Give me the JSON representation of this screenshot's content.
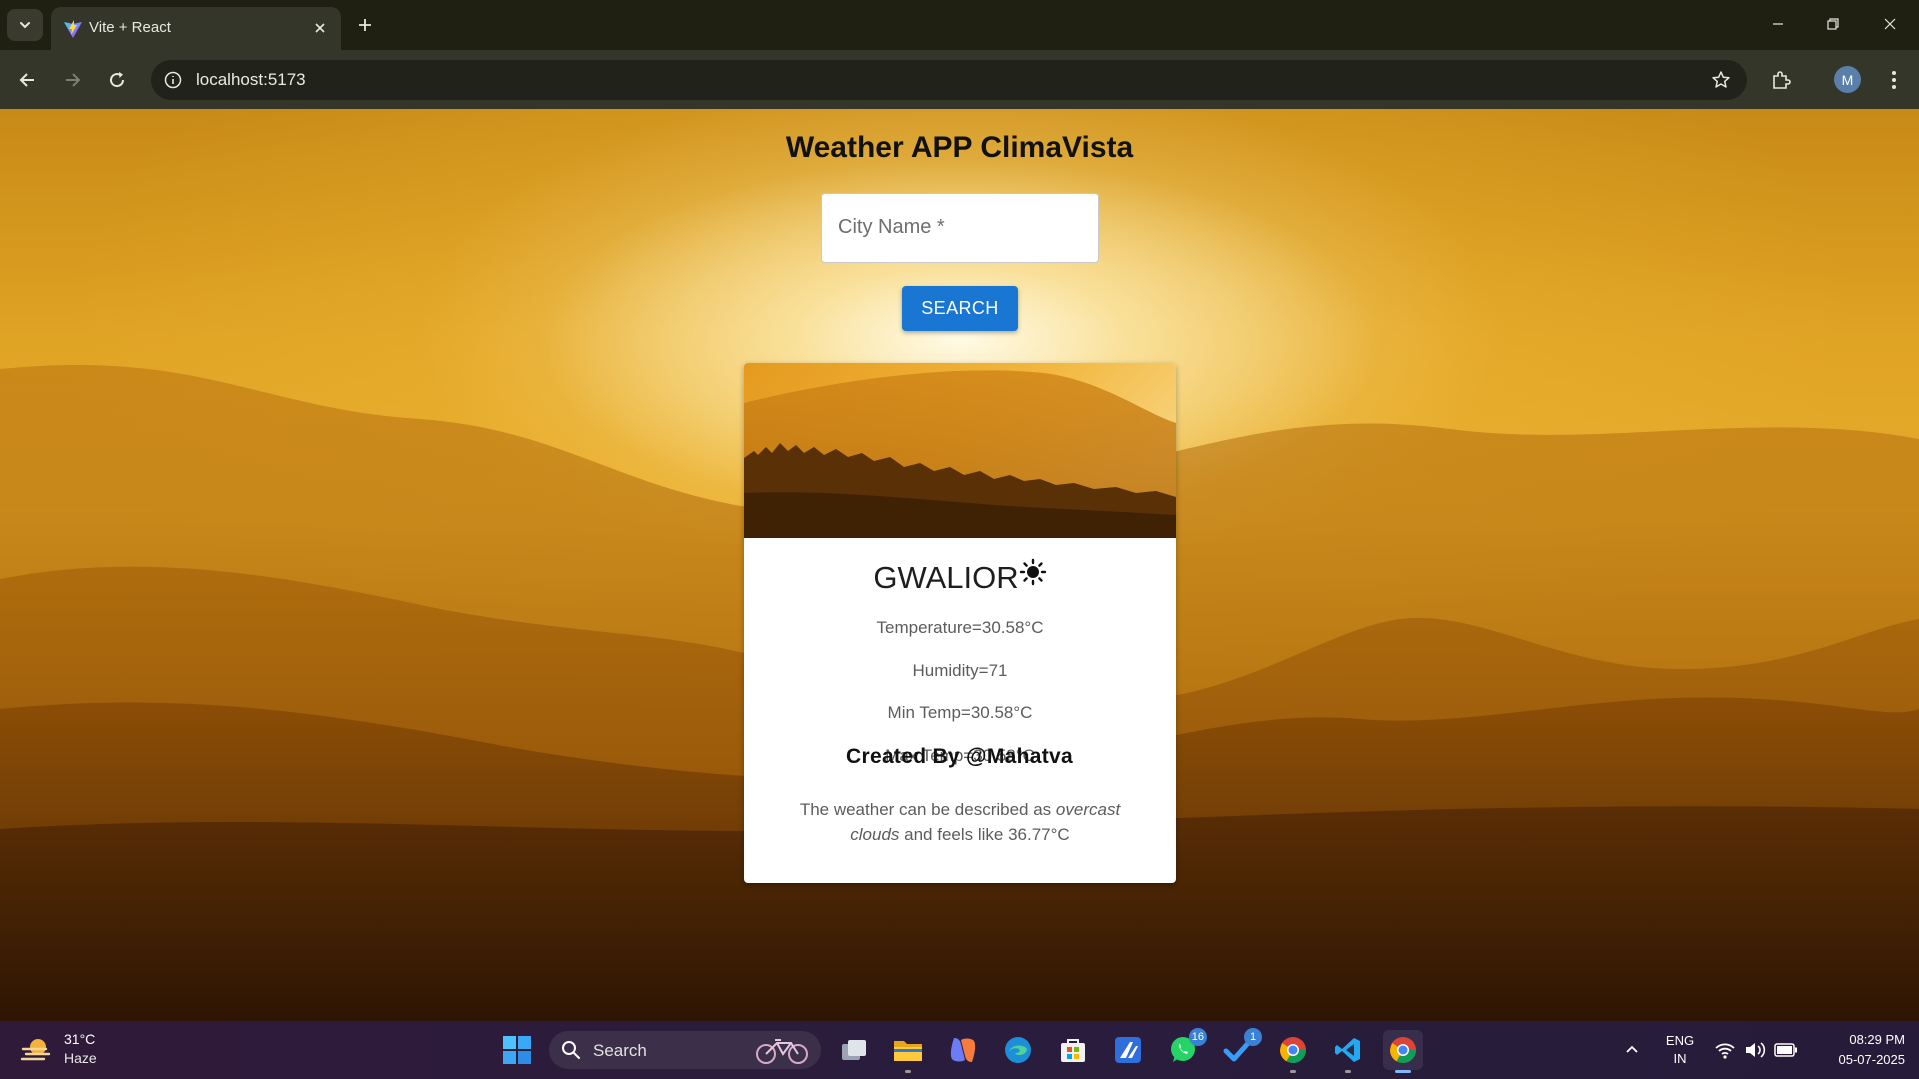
{
  "browser": {
    "tab_title": "Vite + React",
    "url": "localhost:5173",
    "profile_initial": "M"
  },
  "app": {
    "title": "Weather APP ClimaVista",
    "city_label": "City Name *",
    "search_label": "SEARCH",
    "footer": "Created By @Mahatva"
  },
  "weather": {
    "city": "GWALIOR",
    "temperature": "Temperature=30.58°C",
    "humidity": "Humidity=71",
    "min_temp": "Min Temp=30.58°C",
    "max_temp": "Max Temp=30.58°C",
    "desc_prefix": "The weather can be described as",
    "desc_condition": "overcast clouds",
    "desc_suffix": "and feels like 36.77°C",
    "condition_icon": "sun-icon"
  },
  "taskbar": {
    "weather_temp": "31°C",
    "weather_cond": "Haze",
    "search_placeholder": "Search",
    "whatsapp_badge": "16",
    "todo_badge": "1",
    "lang_line1": "ENG",
    "lang_line2": "IN",
    "time": "08:29 PM",
    "date": "05-07-2025",
    "pinned": [
      "task-view",
      "file-explorer",
      "copilot",
      "edge",
      "microsoft-store",
      "app-icon",
      "whatsapp",
      "todo",
      "chrome-profile",
      "vscode",
      "chrome-active"
    ]
  },
  "colors": {
    "accent_button": "#1976d2",
    "titlebar": "#1f2012",
    "toolbar": "#35362a"
  }
}
